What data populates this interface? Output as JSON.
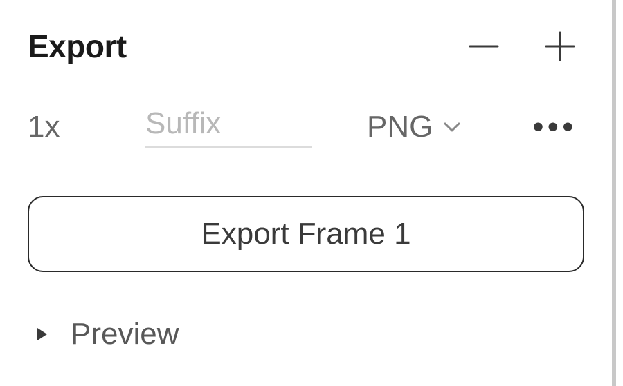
{
  "export": {
    "title": "Export",
    "scale": "1x",
    "suffix_placeholder": "Suffix",
    "suffix_value": "",
    "format": "PNG",
    "button_label": "Export Frame 1",
    "preview_label": "Preview"
  }
}
